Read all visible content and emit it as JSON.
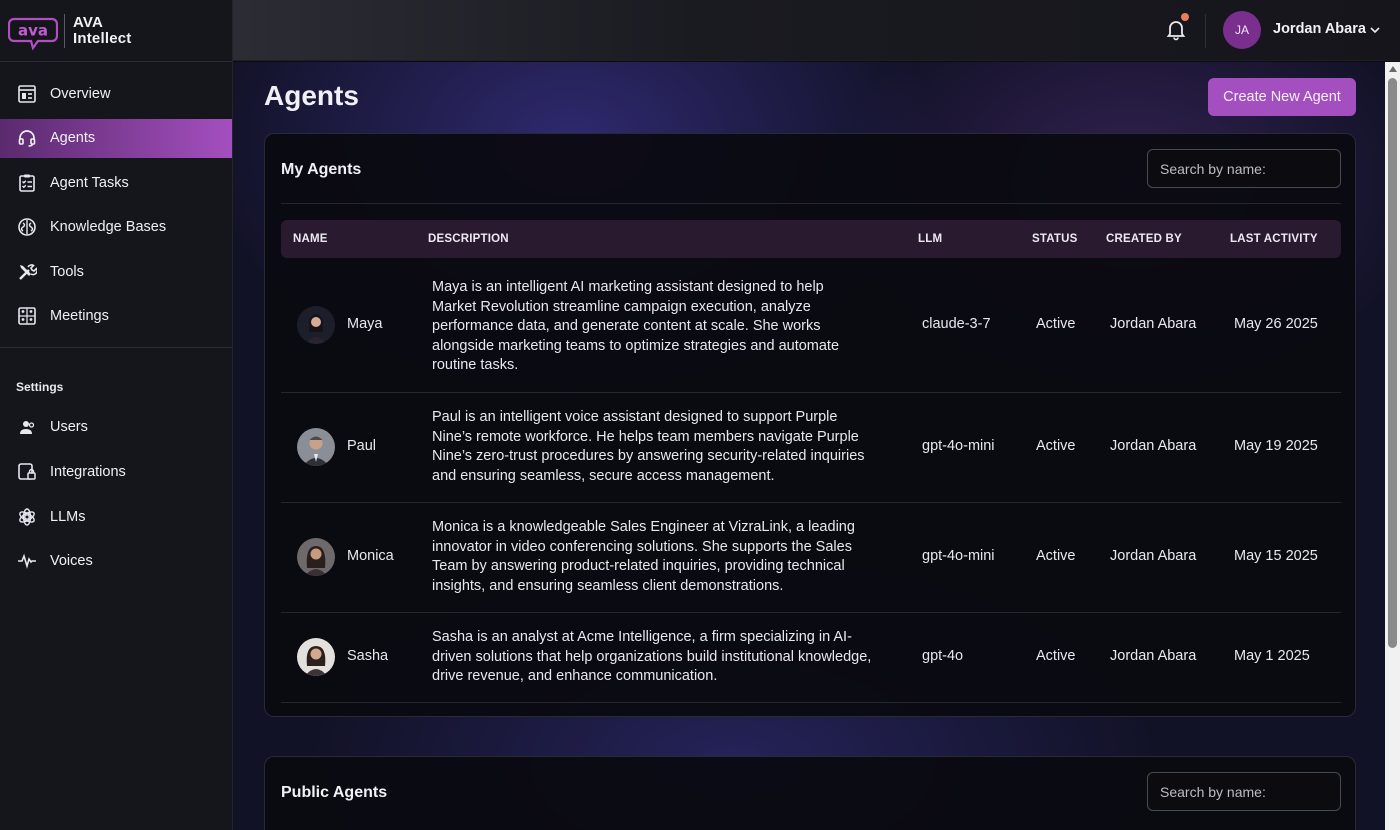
{
  "brand": {
    "logo_text": "ava",
    "name_line1": "AVA",
    "name_line2": "Intellect"
  },
  "nav": {
    "items": [
      {
        "label": "Overview",
        "icon": "dashboard-icon",
        "active": false
      },
      {
        "label": "Agents",
        "icon": "headset-icon",
        "active": true
      },
      {
        "label": "Agent Tasks",
        "icon": "checklist-icon",
        "active": false
      },
      {
        "label": "Knowledge Bases",
        "icon": "brain-icon",
        "active": false
      },
      {
        "label": "Tools",
        "icon": "tools-icon",
        "active": false
      },
      {
        "label": "Meetings",
        "icon": "meeting-icon",
        "active": false
      }
    ],
    "settings_label": "Settings",
    "settings_items": [
      {
        "label": "Users",
        "icon": "users-icon"
      },
      {
        "label": "Integrations",
        "icon": "integrations-icon"
      },
      {
        "label": "LLMs",
        "icon": "llm-icon"
      },
      {
        "label": "Voices",
        "icon": "waveform-icon"
      }
    ]
  },
  "topbar": {
    "user_initials": "JA",
    "user_name": "Jordan Abara"
  },
  "page": {
    "title": "Agents",
    "create_button": "Create New Agent"
  },
  "my_agents": {
    "title": "My Agents",
    "search_placeholder": "Search by name:",
    "columns": [
      "NAME",
      "DESCRIPTION",
      "LLM",
      "STATUS",
      "CREATED BY",
      "LAST ACTIVITY"
    ],
    "rows": [
      {
        "name": "Maya",
        "description": "Maya is an intelligent AI marketing assistant designed to help Market Revolution streamline campaign execution, analyze performance data, and generate content at scale. She works alongside marketing teams to optimize strategies and automate routine tasks.",
        "llm": "claude-3-7",
        "status": "Active",
        "created_by": "Jordan Abara",
        "last_activity": "May 26 2025"
      },
      {
        "name": "Paul",
        "description": "Paul is an intelligent voice assistant designed to support Purple Nine’s remote workforce. He helps team members navigate Purple Nine’s zero-trust procedures by answering security-related inquiries and ensuring seamless, secure access management.",
        "llm": "gpt-4o-mini",
        "status": "Active",
        "created_by": "Jordan Abara",
        "last_activity": "May 19 2025"
      },
      {
        "name": "Monica",
        "description": "Monica is a knowledgeable Sales Engineer at VizraLink, a leading innovator in video conferencing solutions. She supports the Sales Team by answering product-related inquiries, providing technical insights, and ensuring seamless client demonstrations.",
        "llm": "gpt-4o-mini",
        "status": "Active",
        "created_by": "Jordan Abara",
        "last_activity": "May 15 2025"
      },
      {
        "name": "Sasha",
        "description": "Sasha is an analyst at Acme Intelligence, a firm specializing in AI-driven solutions that help organizations build institutional knowledge, drive revenue, and enhance communication.",
        "llm": "gpt-4o",
        "status": "Active",
        "created_by": "Jordan Abara",
        "last_activity": "May 1 2025"
      }
    ]
  },
  "public_agents": {
    "title": "Public Agents",
    "search_placeholder": "Search by name:"
  },
  "colors": {
    "accent": "#a44fbf",
    "sidebar_bg": "#15161c",
    "card_bg": "#0a0a10",
    "header_row_bg": "#2a1a2f"
  }
}
